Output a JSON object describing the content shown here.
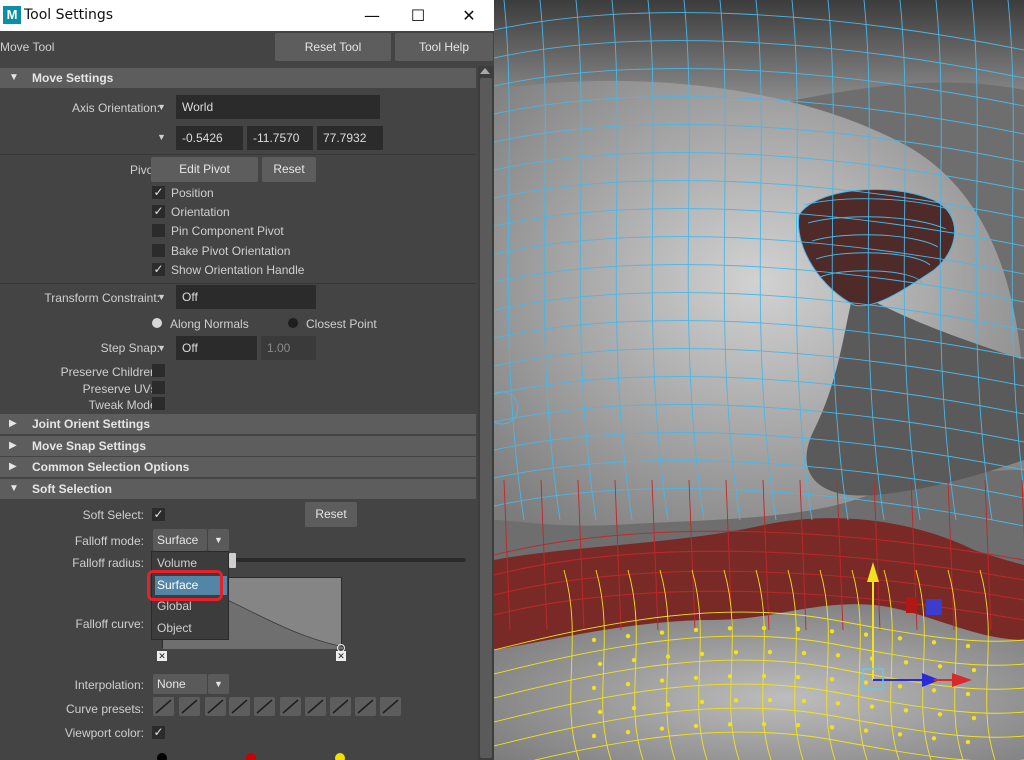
{
  "window": {
    "app_icon": "M",
    "title": "Tool Settings",
    "minimize_icon": "minimize-icon",
    "maximize_icon": "maximize-icon",
    "close_icon": "close-icon"
  },
  "toolbar": {
    "tool_name": "Move Tool",
    "reset_tool_label": "Reset Tool",
    "tool_help_label": "Tool Help"
  },
  "move_settings": {
    "title": "Move Settings",
    "axis_orientation_label": "Axis Orientation:",
    "axis_orientation_value": "World",
    "coords": [
      "-0.5426",
      "-11.7570",
      "77.7932"
    ],
    "pivot_label": "Pivot:",
    "edit_pivot_label": "Edit Pivot",
    "reset_label": "Reset",
    "pivot_options": [
      {
        "label": "Position",
        "checked": true
      },
      {
        "label": "Orientation",
        "checked": true
      },
      {
        "label": "Pin Component Pivot",
        "checked": false
      },
      {
        "label": "Bake Pivot Orientation",
        "checked": false
      },
      {
        "label": "Show Orientation Handle",
        "checked": true
      }
    ],
    "transform_constraint_label": "Transform Constraint:",
    "transform_constraint_value": "Off",
    "along_normals_label": "Along Normals",
    "closest_point_label": "Closest Point",
    "step_snap_label": "Step Snap:",
    "step_snap_value": "Off",
    "step_snap_amount": "1.00",
    "preserve_children_label": "Preserve Children:",
    "preserve_uvs_label": "Preserve UVs:",
    "tweak_mode_label": "Tweak Mode:"
  },
  "sections": {
    "joint_orient": "Joint Orient Settings",
    "move_snap": "Move Snap Settings",
    "common_selection": "Common Selection Options",
    "soft_selection": "Soft Selection"
  },
  "soft_selection": {
    "soft_select_label": "Soft Select:",
    "soft_select_checked": true,
    "reset_label": "Reset",
    "falloff_mode_label": "Falloff mode:",
    "falloff_mode_value": "Surface",
    "falloff_radius_label": "Falloff radius:",
    "falloff_mode_options": [
      "Volume",
      "Surface",
      "Global",
      "Object"
    ],
    "falloff_mode_highlighted": "Surface",
    "falloff_curve_label": "Falloff curve:",
    "interpolation_label": "Interpolation:",
    "interpolation_value": "None",
    "curve_presets_label": "Curve presets:",
    "viewport_color_label": "Viewport color:",
    "viewport_color_checked": true,
    "color_keys": [
      "#000000",
      "#cc0000",
      "#f0e000"
    ]
  },
  "colors": {
    "panel_bg": "#444444",
    "section_bg": "#5d5d5d",
    "field_bg": "#2b2b2b",
    "highlight": "#5285a6",
    "annotation_red": "#e8202c",
    "wire_blue": "#49b7e8",
    "wire_yellow": "#f2e21b",
    "selection_red": "#7a2a26"
  }
}
